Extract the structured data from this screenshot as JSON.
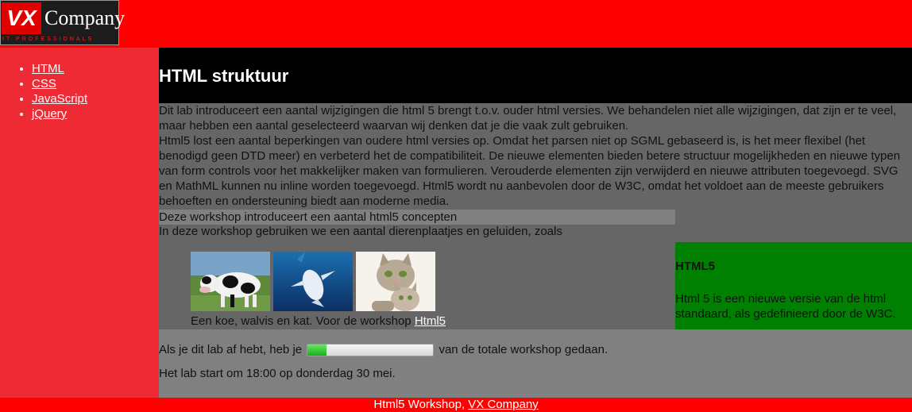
{
  "logo": {
    "mark": "VX",
    "name": "Company",
    "tagline": "IT PROFESSIONALS"
  },
  "nav": {
    "items": [
      {
        "label": "HTML"
      },
      {
        "label": "CSS"
      },
      {
        "label": "JavaScript"
      },
      {
        "label": "jQuery"
      }
    ]
  },
  "header": {
    "title": "HTML struktuur"
  },
  "article": {
    "p1": "Dit lab introduceert een aantal wijzigingen die html 5 brengt t.o.v. ouder html versies. We behandelen niet alle wijzigingen, dat zijn er te veel, maar hebben een aantal geselecteerd waarvan wij denken dat je die vaak zult gebruiken.",
    "p2": "Html5 lost een aantal beperkingen van oudere html versies op. Omdat het parsen niet op SGML gebaseerd is, is het meer flexibel (het benodigd geen DTD meer) en verbeterd het de compatibiliteit. De nieuwe elementen bieden betere structuur mogelijkheden en nieuwe typen van form controls voor het makkelijker maken van formulieren. Verouderde elementen zijn verwijderd en nieuwe attributen toegevoegd. SVG en MathML kunnen nu inline worden toegevoegd. Html5 wordt nu aanbevolen door de W3C, omdat het voldoet aan de meeste gebruikers behoeften en ondersteuning biedt aan moderne media.",
    "highlight": "Deze workshop introduceert een aantal html5 concepten",
    "p3": "In deze workshop gebruiken we een aantal dierenplaatjes en geluiden, zoals",
    "images": [
      {
        "name": "cow"
      },
      {
        "name": "whale"
      },
      {
        "name": "cat"
      }
    ],
    "caption_text": "Een koe, walvis en kat. Voor de workshop ",
    "caption_link": "Html5"
  },
  "aside": {
    "title": "HTML5",
    "text": "Html 5 is een nieuwe versie van de html standaard, als gedefinieerd door de W3C."
  },
  "progress": {
    "before": "Als je dit lab af hebt, heb je",
    "after": "van de totale workshop gedaan.",
    "fraction": 0.15
  },
  "schedule": {
    "text": "Het lab start om 18:00 op donderdag 30 mei."
  },
  "footer": {
    "text": "Html5 Workshop, ",
    "link": "VX Company"
  },
  "colors": {
    "header_bg": "#ff0000",
    "sidebar_bg": "#ee2b35",
    "aside_bg": "#008000",
    "title_bg": "#000000",
    "content_bg": "#666666"
  }
}
